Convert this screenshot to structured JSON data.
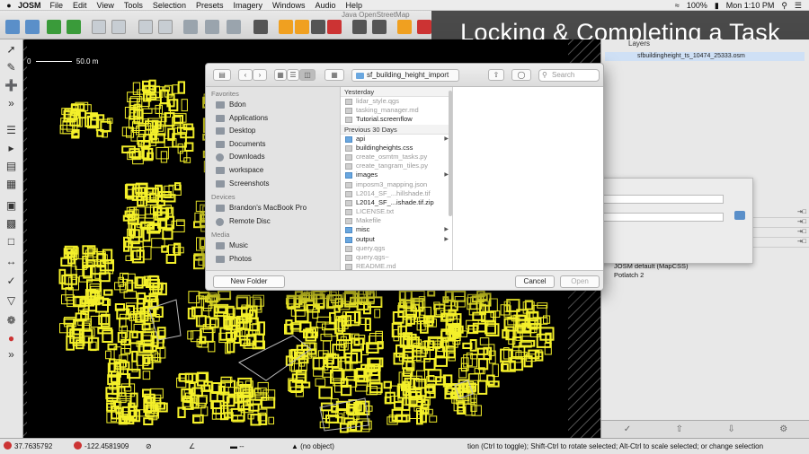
{
  "menubar": {
    "apple": "",
    "app": "JOSM",
    "items": [
      "File",
      "Edit",
      "View",
      "Tools",
      "Selection",
      "Presets",
      "Imagery",
      "Windows",
      "Audio",
      "Help"
    ],
    "battery": "100%",
    "clock": "Mon 1:10 PM"
  },
  "window_title": "Java OpenStreetMap",
  "overlay": {
    "title": "Locking & Completing a Task"
  },
  "map": {
    "scale_label": "50.0 m",
    "scale_zero": "0"
  },
  "layers": {
    "title": "Layers",
    "active_layer": "sfbuildingheight_ts_10474_25333.osm"
  },
  "file_dialog": {
    "current_folder": "sf_building_height_import",
    "search_placeholder": "Search",
    "sidebar": {
      "favorites_header": "Favorites",
      "favorites": [
        "Bdon",
        "Applications",
        "Desktop",
        "Documents",
        "Downloads",
        "workspace",
        "Screenshots"
      ],
      "devices_header": "Devices",
      "devices": [
        "Brandon's MacBook Pro",
        "Remote Disc"
      ],
      "media_header": "Media",
      "media": [
        "Music",
        "Photos"
      ]
    },
    "files": {
      "yesterday_header": "Yesterday",
      "yesterday": [
        {
          "name": "lidar_style.qgs",
          "dim": true,
          "folder": false
        },
        {
          "name": "tasking_manager.md",
          "dim": true,
          "folder": false
        },
        {
          "name": "Tutorial.screenflow",
          "dim": false,
          "folder": false
        }
      ],
      "previous_header": "Previous 30 Days",
      "previous": [
        {
          "name": "api",
          "dim": false,
          "folder": true
        },
        {
          "name": "buildingheights.css",
          "dim": false,
          "folder": false
        },
        {
          "name": "create_osmtm_tasks.py",
          "dim": true,
          "folder": false
        },
        {
          "name": "create_tangram_tiles.py",
          "dim": true,
          "folder": false
        },
        {
          "name": "images",
          "dim": false,
          "folder": true
        },
        {
          "name": "imposm3_mapping.json",
          "dim": true,
          "folder": false
        },
        {
          "name": "L2014_SF_...hillshade.tif",
          "dim": true,
          "folder": false
        },
        {
          "name": "L2014_SF_...ishade.tif.zip",
          "dim": false,
          "folder": false
        },
        {
          "name": "LICENSE.txt",
          "dim": true,
          "folder": false
        },
        {
          "name": "Makefile",
          "dim": true,
          "folder": false
        },
        {
          "name": "misc",
          "dim": false,
          "folder": true
        },
        {
          "name": "output",
          "dim": false,
          "folder": true
        },
        {
          "name": "query.qgs",
          "dim": true,
          "folder": false
        },
        {
          "name": "query.qgs~",
          "dim": true,
          "folder": false
        },
        {
          "name": "README.md",
          "dim": true,
          "folder": false
        }
      ]
    },
    "new_folder_label": "New Folder",
    "cancel_label": "Cancel",
    "open_label": "Open"
  },
  "styles": [
    {
      "label": "JOSM default (MapCSS)"
    },
    {
      "label": "Potlatch 2"
    }
  ],
  "statusbar": {
    "lat": "37.7635792",
    "lon": "-122.4581909",
    "dist": "--",
    "selection": "(no object)",
    "help": "tion (Ctrl to toggle); Shift-Ctrl to rotate selected; Alt-Ctrl to scale selected; or change selection"
  },
  "colors": {
    "building": "#f4f02a",
    "map_bg": "#000000",
    "folder": "#6aa7df"
  }
}
